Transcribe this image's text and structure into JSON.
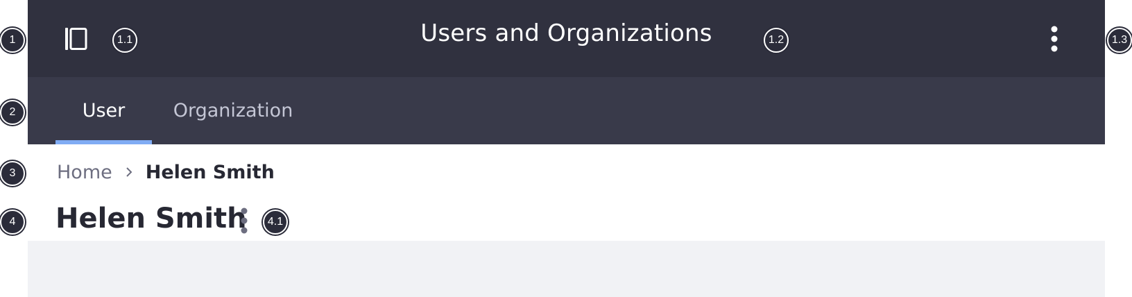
{
  "header": {
    "title": "Users and Organizations",
    "sidebar_toggle_icon": "sidebar-toggle-icon",
    "options_icon": "kebab-vertical-icon",
    "background": "#30313f"
  },
  "tabs": [
    {
      "label": "User",
      "active": true
    },
    {
      "label": "Organization",
      "active": false
    }
  ],
  "tabs_style": {
    "background": "#393a4a",
    "active_indicator": "#80acf4"
  },
  "breadcrumb": {
    "home": "Home",
    "separator_icon": "chevron-right-icon",
    "current": "Helen Smith"
  },
  "page": {
    "title": "Helen Smith",
    "options_icon": "kebab-vertical-icon"
  },
  "markers": {
    "m1": "1",
    "m1_1": "1.1",
    "m1_2": "1.2",
    "m1_3": "1.3",
    "m2": "2",
    "m3": "3",
    "m4": "4",
    "m4_1": "4.1"
  }
}
